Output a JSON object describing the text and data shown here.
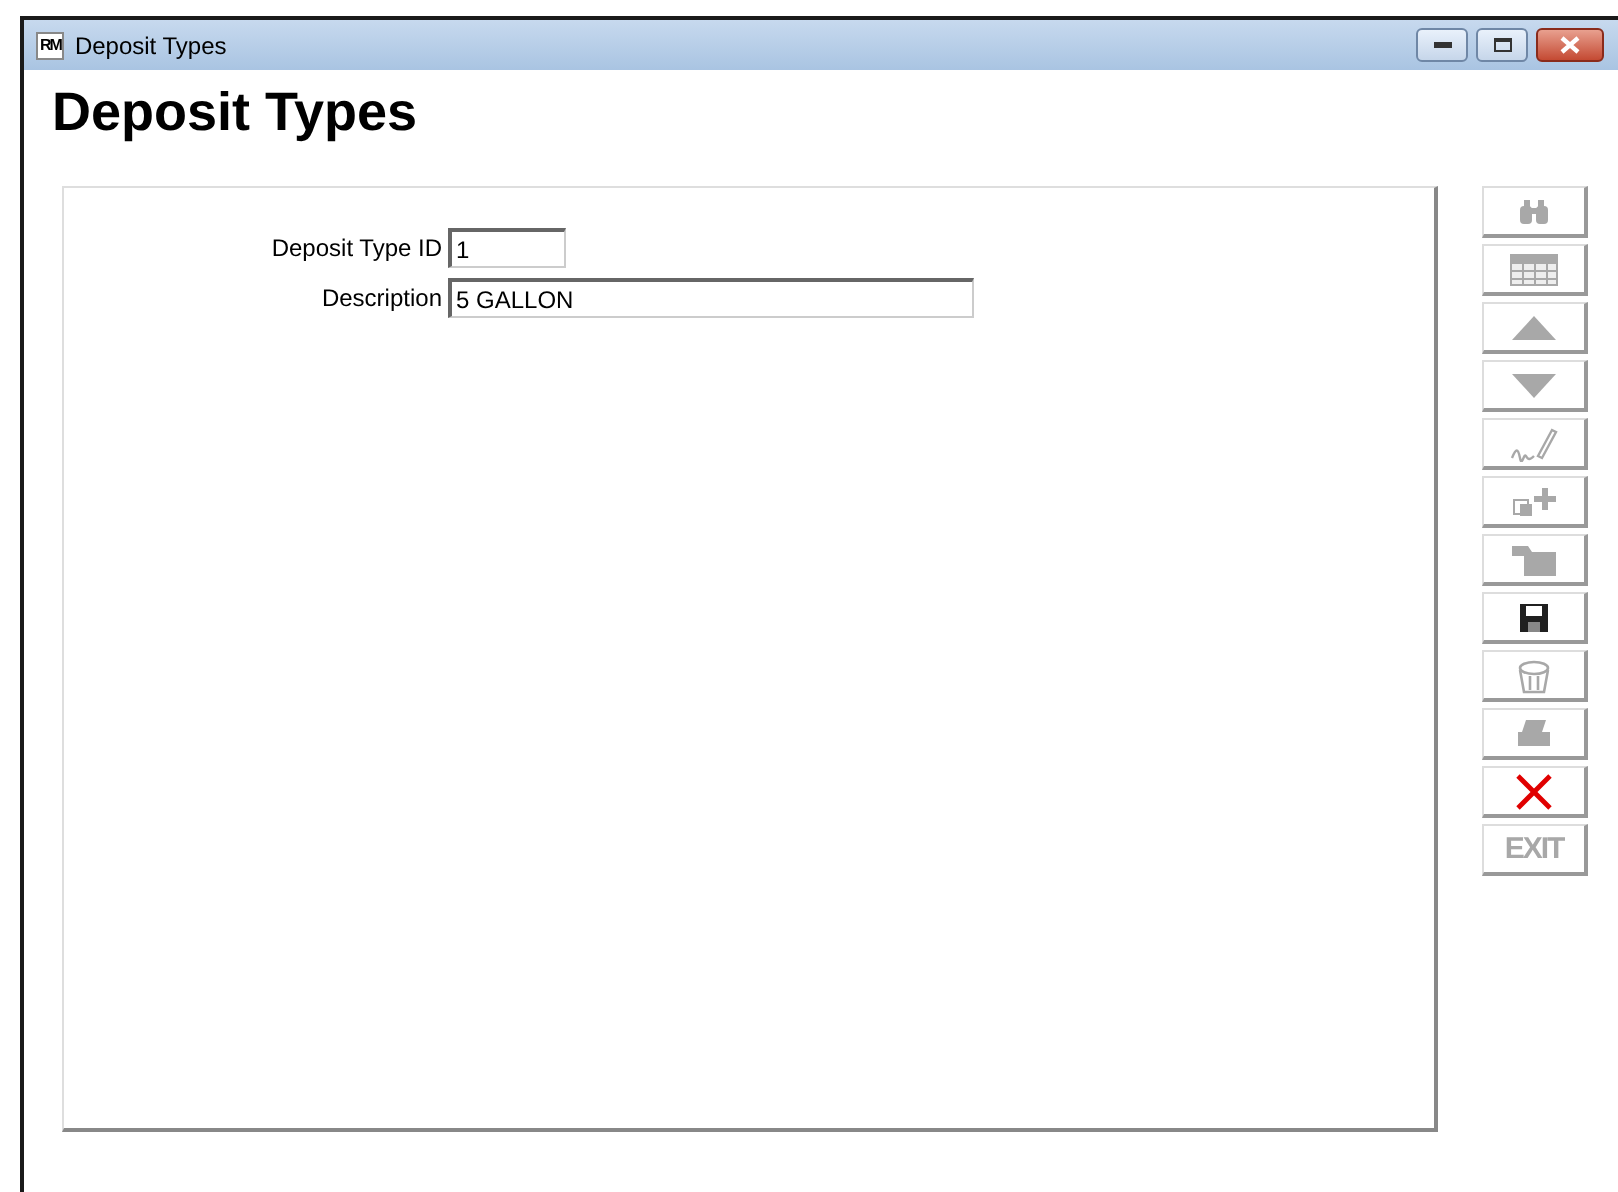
{
  "window": {
    "logo": "RM",
    "title": "Deposit Types"
  },
  "heading": "Deposit Types",
  "fields": [
    {
      "label": "Deposit Type ID",
      "value": "1",
      "kind": "short"
    },
    {
      "label": "Description",
      "value": "5 GALLON",
      "kind": "long"
    }
  ],
  "toolbar": [
    {
      "kind": "find",
      "disabled": true
    },
    {
      "kind": "grid",
      "disabled": true
    },
    {
      "kind": "up",
      "disabled": true
    },
    {
      "kind": "down",
      "disabled": true
    },
    {
      "kind": "sign",
      "disabled": true
    },
    {
      "kind": "add",
      "disabled": true
    },
    {
      "kind": "folder",
      "disabled": true
    },
    {
      "kind": "save",
      "disabled": false
    },
    {
      "kind": "trash",
      "disabled": true
    },
    {
      "kind": "print",
      "disabled": true
    },
    {
      "kind": "cancel",
      "disabled": false
    },
    {
      "kind": "text",
      "label": "EXIT",
      "disabled": true
    }
  ]
}
